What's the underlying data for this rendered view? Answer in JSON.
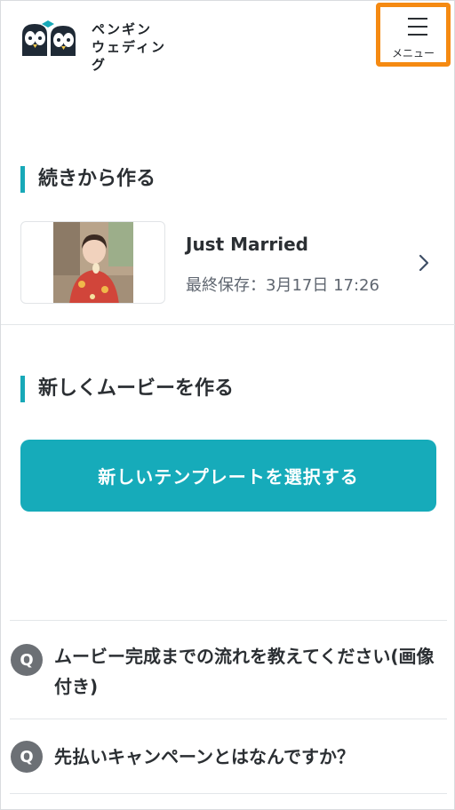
{
  "header": {
    "logo_line1": "ペンギン",
    "logo_line2": "ウェディング",
    "menu_label": "メニュー"
  },
  "continue_section": {
    "heading": "続きから作る",
    "item": {
      "title": "Just Married",
      "meta": "最終保存：3月17日 17:26"
    }
  },
  "new_section": {
    "heading": "新しくムービーを作る",
    "button_label": "新しいテンプレートを選択する"
  },
  "faq": [
    {
      "badge": "Q",
      "question": "ムービー完成までの流れを教えてください(画像付き)"
    },
    {
      "badge": "Q",
      "question": "先払いキャンペーンとはなんですか？"
    }
  ],
  "colors": {
    "accent": "#16abba",
    "menu_highlight": "#f58a12",
    "badge": "#6c7075"
  },
  "icons": {
    "logo": "penguin-logo-icon",
    "menu": "hamburger-icon",
    "chevron": "chevron-right-icon"
  }
}
